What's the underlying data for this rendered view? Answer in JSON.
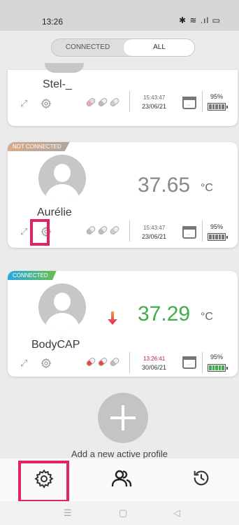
{
  "status_bar": {
    "time": "13:26",
    "icons": "✱ ≋ .ıl ▭"
  },
  "segment": {
    "connected_label": "CONNECTED",
    "all_label": "ALL"
  },
  "profiles": [
    {
      "name": "Stel-_",
      "time": "15:43:47",
      "date": "23/06/21",
      "battery": "95%",
      "battery_color": "#777777"
    },
    {
      "badge": "NOT CONNECTED",
      "name": "Aurélie",
      "temperature": "37.65",
      "unit": "°C",
      "time": "15:43:47",
      "date": "23/06/21",
      "battery": "95%",
      "battery_color": "#777777"
    },
    {
      "badge": "CONNECTED",
      "name": "BodyCAP",
      "temperature": "37.29",
      "unit": "°C",
      "trend": "arrow-down",
      "time": "13:26:41",
      "date": "30/06/21",
      "battery": "95%",
      "battery_color": "#3fae4a",
      "temperature_color": "#3fae4a",
      "time_color": "#c2185b"
    }
  ],
  "add_profile": {
    "label": "Add a new active profile"
  },
  "bottom_nav": {
    "items": [
      {
        "icon": "gear-icon"
      },
      {
        "icon": "users-icon"
      },
      {
        "icon": "history-icon"
      }
    ]
  },
  "system_nav": {
    "menu": "☰",
    "home": "▢",
    "back": "◁"
  },
  "colors": {
    "highlight": "#e0245e",
    "accent_green": "#3fae4a"
  }
}
